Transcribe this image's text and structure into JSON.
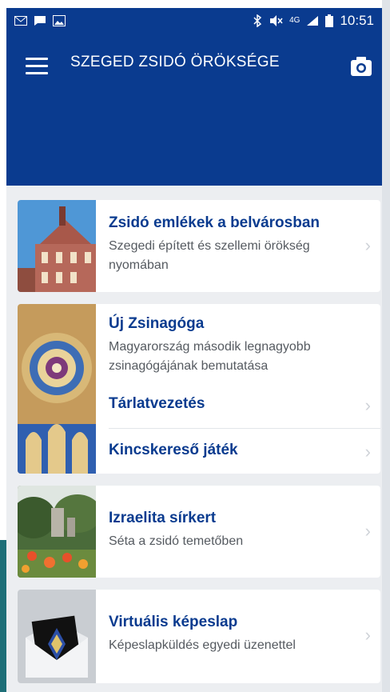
{
  "status_bar": {
    "icons_left": [
      "mail-icon",
      "message-icon",
      "image-icon"
    ],
    "icons_right": [
      "bluetooth-icon",
      "mute-icon",
      "network-4g-icon",
      "signal-icon",
      "battery-icon"
    ],
    "network": "4G",
    "time": "10:51"
  },
  "app_bar": {
    "title": "SZEGED ZSIDÓ ÖRÖKSÉGE",
    "color": "#0a3b8f"
  },
  "cards": [
    {
      "title": "Zsidó emlékek a belvárosban",
      "subtitle_lines": [
        "Szegedi épített és szellemi örökség",
        "nyomában"
      ]
    },
    {
      "title": "Új Zsinagóga",
      "subtitle_lines": [
        "Magyarország második legnagyobb",
        "zsinagógájának bemutatása"
      ],
      "links": [
        "Tárlatvezetés",
        "Kincskereső játék"
      ]
    },
    {
      "title": "Izraelita sírkert",
      "subtitle_lines": [
        "Séta a zsidó temetőben"
      ]
    },
    {
      "title": "Virtuális képeslap",
      "subtitle_lines": [
        "Képeslapküldés egyedi üzenettel"
      ]
    }
  ]
}
